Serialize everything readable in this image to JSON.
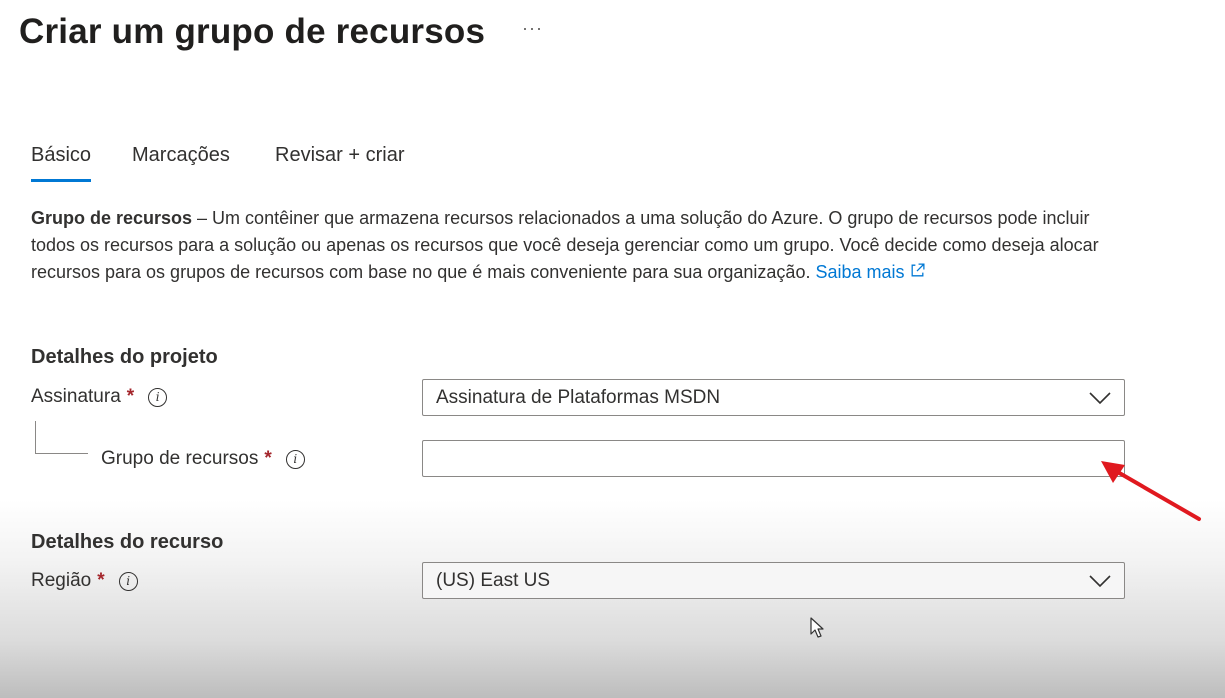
{
  "page": {
    "title": "Criar um grupo de recursos",
    "more_label": "···"
  },
  "tabs": [
    {
      "label": "Básico",
      "active": true
    },
    {
      "label": "Marcações",
      "active": false
    },
    {
      "label": "Revisar + criar",
      "active": false
    }
  ],
  "description": {
    "bold": "Grupo de recursos",
    "text": " – Um contêiner que armazena recursos relacionados a uma solução do Azure. O grupo de recursos pode incluir todos os recursos para a solução ou apenas os recursos que você deseja gerenciar como um grupo. Você decide como deseja alocar recursos para os grupos de recursos com base no que é mais conveniente para sua organização. ",
    "link": "Saiba mais"
  },
  "project_details": {
    "heading": "Detalhes do projeto",
    "subscription": {
      "label": "Assinatura",
      "required": "*",
      "value": "Assinatura de Plataformas MSDN"
    },
    "resource_group": {
      "label": "Grupo de recursos",
      "required": "*",
      "value": ""
    }
  },
  "resource_details": {
    "heading": "Detalhes do recurso",
    "region": {
      "label": "Região",
      "required": "*",
      "value": "(US) East US"
    }
  },
  "icons": {
    "info": "info-icon",
    "chevron": "chevron-down-icon",
    "external": "external-link-icon"
  },
  "colors": {
    "accent": "#0078d4",
    "required": "#a4262c",
    "annotation_arrow": "#e0191f"
  }
}
